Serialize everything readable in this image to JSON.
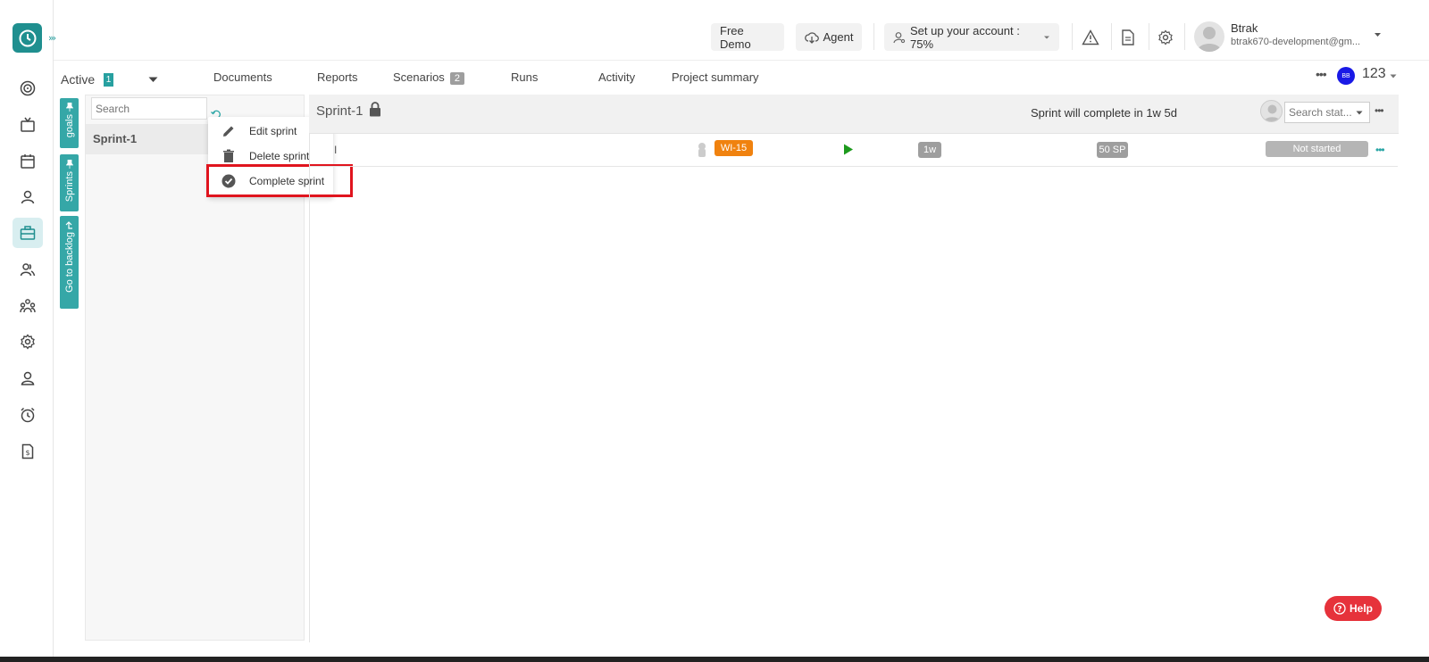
{
  "header": {
    "free_demo": "Free Demo",
    "agent": "Agent",
    "setup": "Set up your account : 75%",
    "user_name": "Btrak",
    "user_email": "btrak670-development@gm..."
  },
  "tabs": {
    "active_label": "Active",
    "active_count": "1",
    "items": [
      "Documents",
      "Reports",
      "Scenarios",
      "Runs",
      "Activity",
      "Project summary"
    ],
    "scenarios_count": "2",
    "avatar_initials": "BB",
    "project_count": "123"
  },
  "vertical_tabs": {
    "goals": "goals",
    "sprints": "Sprints",
    "backlog": "Go to backlog"
  },
  "sprint_list": {
    "search_placeholder": "Search",
    "sprint_name": "Sprint-1"
  },
  "context_menu": {
    "edit": "Edit sprint",
    "delete": "Delete sprint",
    "complete": "Complete sprint"
  },
  "main": {
    "title": "Sprint-1",
    "completion_note": "Sprint will complete in 1w 5d",
    "status_search_placeholder": "Search stat...",
    "task": {
      "name": "I",
      "id": "WI-15",
      "estimate": "1w",
      "story_points": "50 SP",
      "status": "Not started"
    }
  },
  "help": {
    "label": "Help"
  },
  "colors": {
    "accent": "#27a0a0",
    "highlight": "#e0141e",
    "wi_badge": "#f0820f",
    "help": "#e6323b"
  }
}
